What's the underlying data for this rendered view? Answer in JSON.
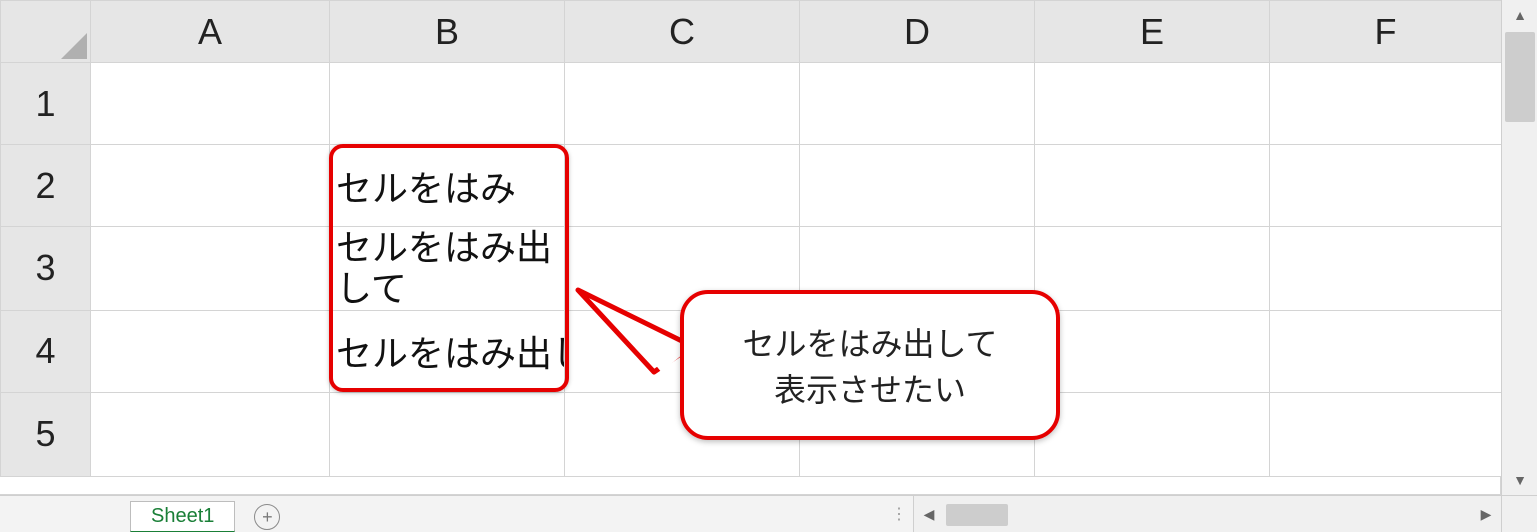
{
  "columns": [
    "A",
    "B",
    "C",
    "D",
    "E",
    "F"
  ],
  "rows": [
    "1",
    "2",
    "3",
    "4",
    "5"
  ],
  "cells": {
    "B2": "セルをはみ",
    "B3": "セルをはみ出して",
    "B4": "セルをはみ出して表示する"
  },
  "callout": {
    "line1": "セルをはみ出して",
    "line2": "表示させたい"
  },
  "sheet_tab": "Sheet1"
}
